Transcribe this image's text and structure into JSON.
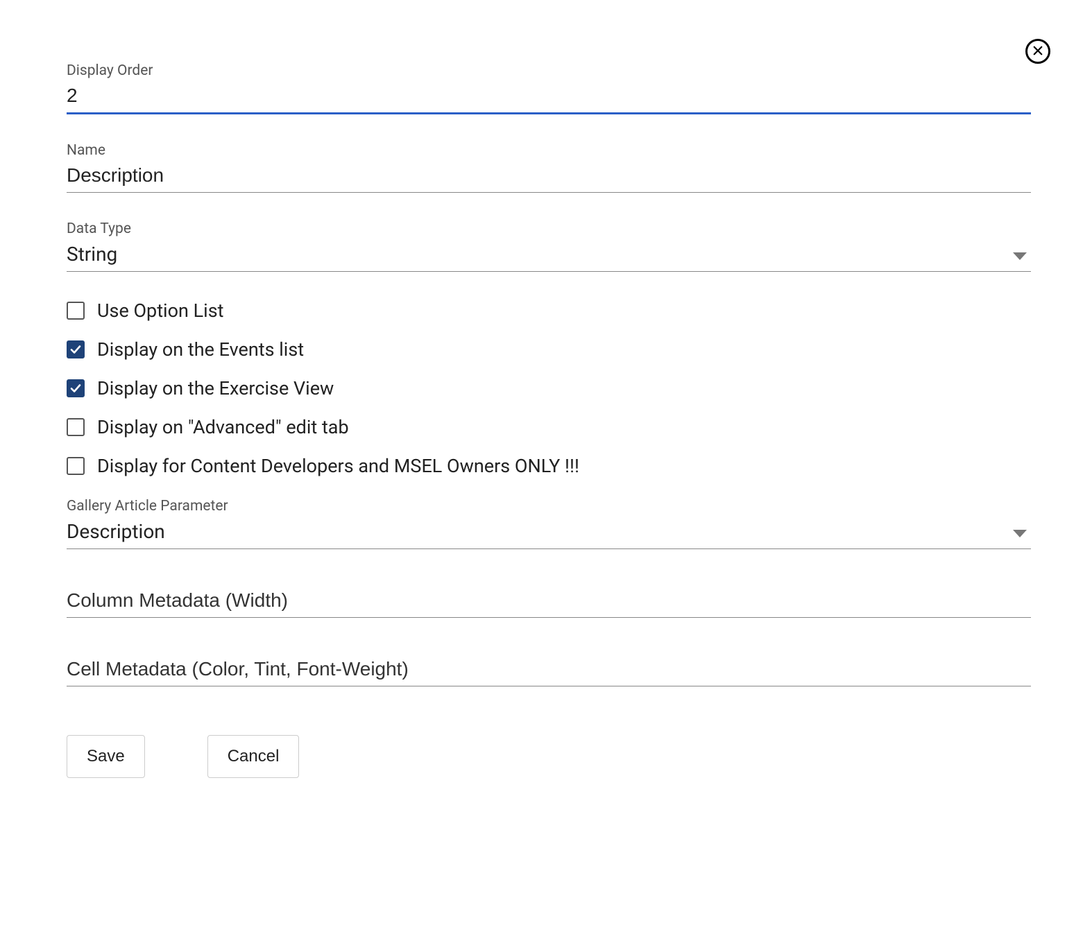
{
  "close_label": "Close",
  "fields": {
    "display_order": {
      "label": "Display Order",
      "value": "2"
    },
    "name": {
      "label": "Name",
      "value": "Description"
    },
    "data_type": {
      "label": "Data Type",
      "value": "String"
    },
    "gallery_article_parameter": {
      "label": "Gallery Article Parameter",
      "value": "Description"
    },
    "column_metadata": {
      "placeholder": "Column Metadata (Width)"
    },
    "cell_metadata": {
      "placeholder": "Cell Metadata (Color, Tint, Font-Weight)"
    }
  },
  "checkboxes": {
    "use_option_list": {
      "label": "Use Option List",
      "checked": false
    },
    "display_events_list": {
      "label": "Display on the Events list",
      "checked": true
    },
    "display_exercise_view": {
      "label": "Display on the Exercise View",
      "checked": true
    },
    "display_advanced_edit": {
      "label": "Display on \"Advanced\" edit tab",
      "checked": false
    },
    "display_owners_only": {
      "label": "Display for Content Developers and MSEL Owners ONLY !!!",
      "checked": false
    }
  },
  "buttons": {
    "save": "Save",
    "cancel": "Cancel"
  }
}
